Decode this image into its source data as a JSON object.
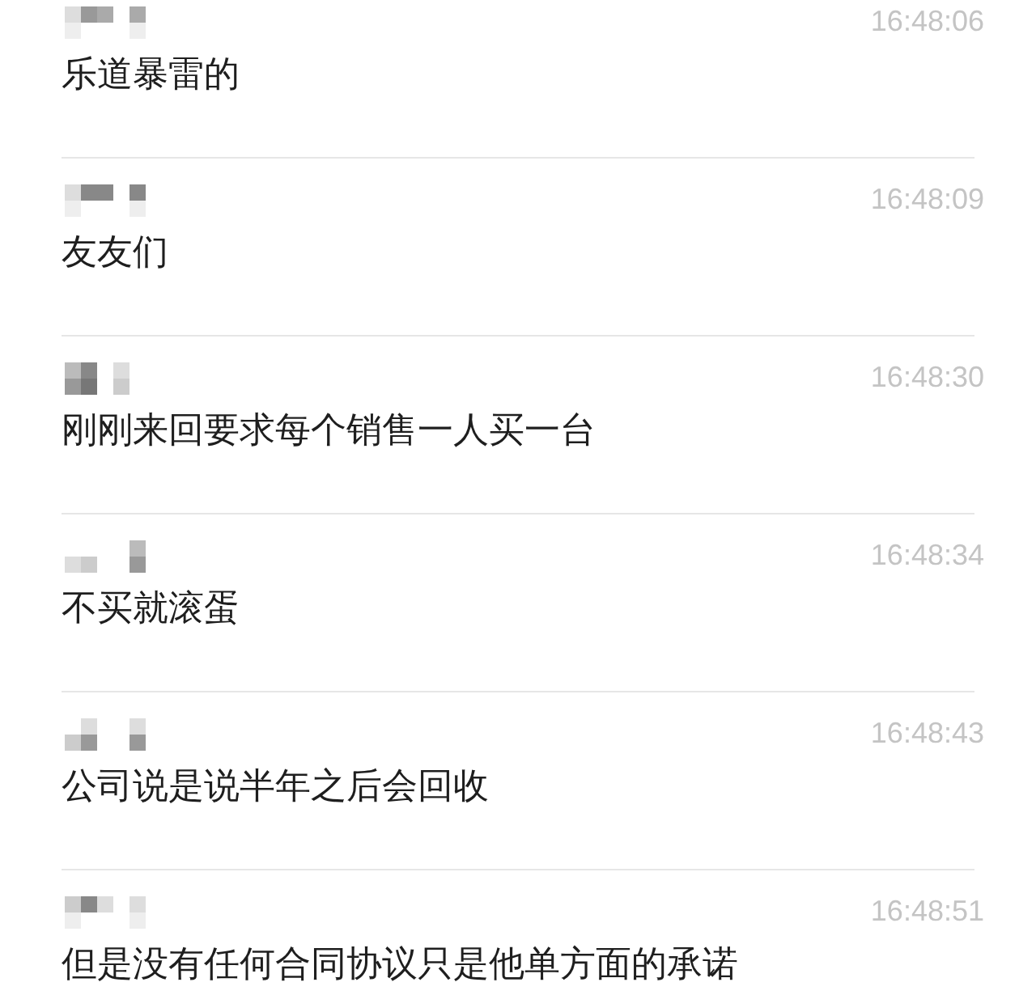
{
  "messages": [
    {
      "time": "16:48:06",
      "text": "乐道暴雷的"
    },
    {
      "time": "16:48:09",
      "text": "友友们"
    },
    {
      "time": "16:48:30",
      "text": "刚刚来回要求每个销售一人买一台"
    },
    {
      "time": "16:48:34",
      "text": "不买就滚蛋"
    },
    {
      "time": "16:48:43",
      "text": "公司说是说半年之后会回收"
    },
    {
      "time": "16:48:51",
      "text": "但是没有任何合同协议只是他单方面的承诺"
    }
  ]
}
